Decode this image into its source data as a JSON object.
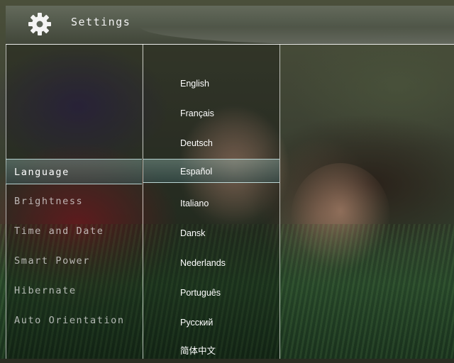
{
  "header": {
    "title": "Settings",
    "icon": "gear-icon"
  },
  "settings_menu": {
    "selected": "Language",
    "items": [
      {
        "label": "Language"
      },
      {
        "label": "Brightness"
      },
      {
        "label": "Time and Date"
      },
      {
        "label": "Smart Power"
      },
      {
        "label": "Hibernate"
      },
      {
        "label": "Auto Orientation"
      }
    ]
  },
  "language_list": {
    "selected": "Español",
    "items": [
      {
        "label": "English"
      },
      {
        "label": "Français"
      },
      {
        "label": "Deutsch"
      },
      {
        "label": "Español"
      },
      {
        "label": "Italiano"
      },
      {
        "label": "Dansk"
      },
      {
        "label": "Nederlands"
      },
      {
        "label": "Português"
      },
      {
        "label": "Русский"
      },
      {
        "label": "简体中文"
      }
    ]
  },
  "colors": {
    "highlight": "#5f8f8c",
    "text": "#ffffff"
  }
}
